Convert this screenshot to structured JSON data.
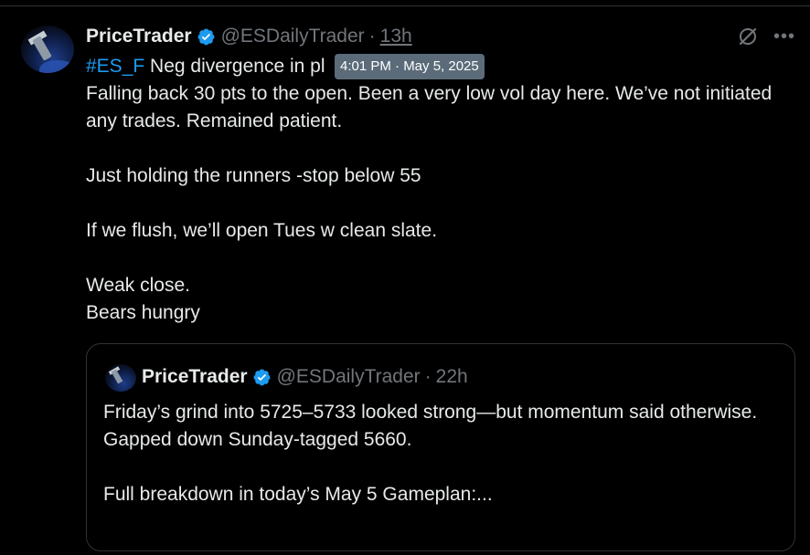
{
  "tweet": {
    "display_name": "PriceTrader",
    "handle": "@ESDailyTrader",
    "separator": "·",
    "time": "13h",
    "tooltip": "4:01 PM · May 5, 2025",
    "hashtag": "#ES_F",
    "first_line_rest": " Neg divergence in pl",
    "body": "Falling back 30 pts to the open. Been a very low vol day here. We’ve not initiated any trades. Remained patient.\n\nJust holding the runners -stop below 55\n\nIf we flush, we’ll open Tues w clean slate.\n\nWeak close.\nBears hungry",
    "grok_icon": "grok-slash-circle-icon",
    "more_icon": "more-dots-icon"
  },
  "quote": {
    "display_name": "PriceTrader",
    "handle": "@ESDailyTrader",
    "separator": "·",
    "time": "22h",
    "text": "Friday’s grind into 5725–5733 looked strong—but momentum said otherwise.\nGapped down Sunday-tagged 5660.\n\nFull breakdown in today’s May 5 Gameplan:..."
  },
  "colors": {
    "background": "#000000",
    "text": "#e7e9ea",
    "muted": "#71767b",
    "accent": "#1d9bf0",
    "border": "#2f3336",
    "tooltip_bg": "#5b6b79"
  }
}
